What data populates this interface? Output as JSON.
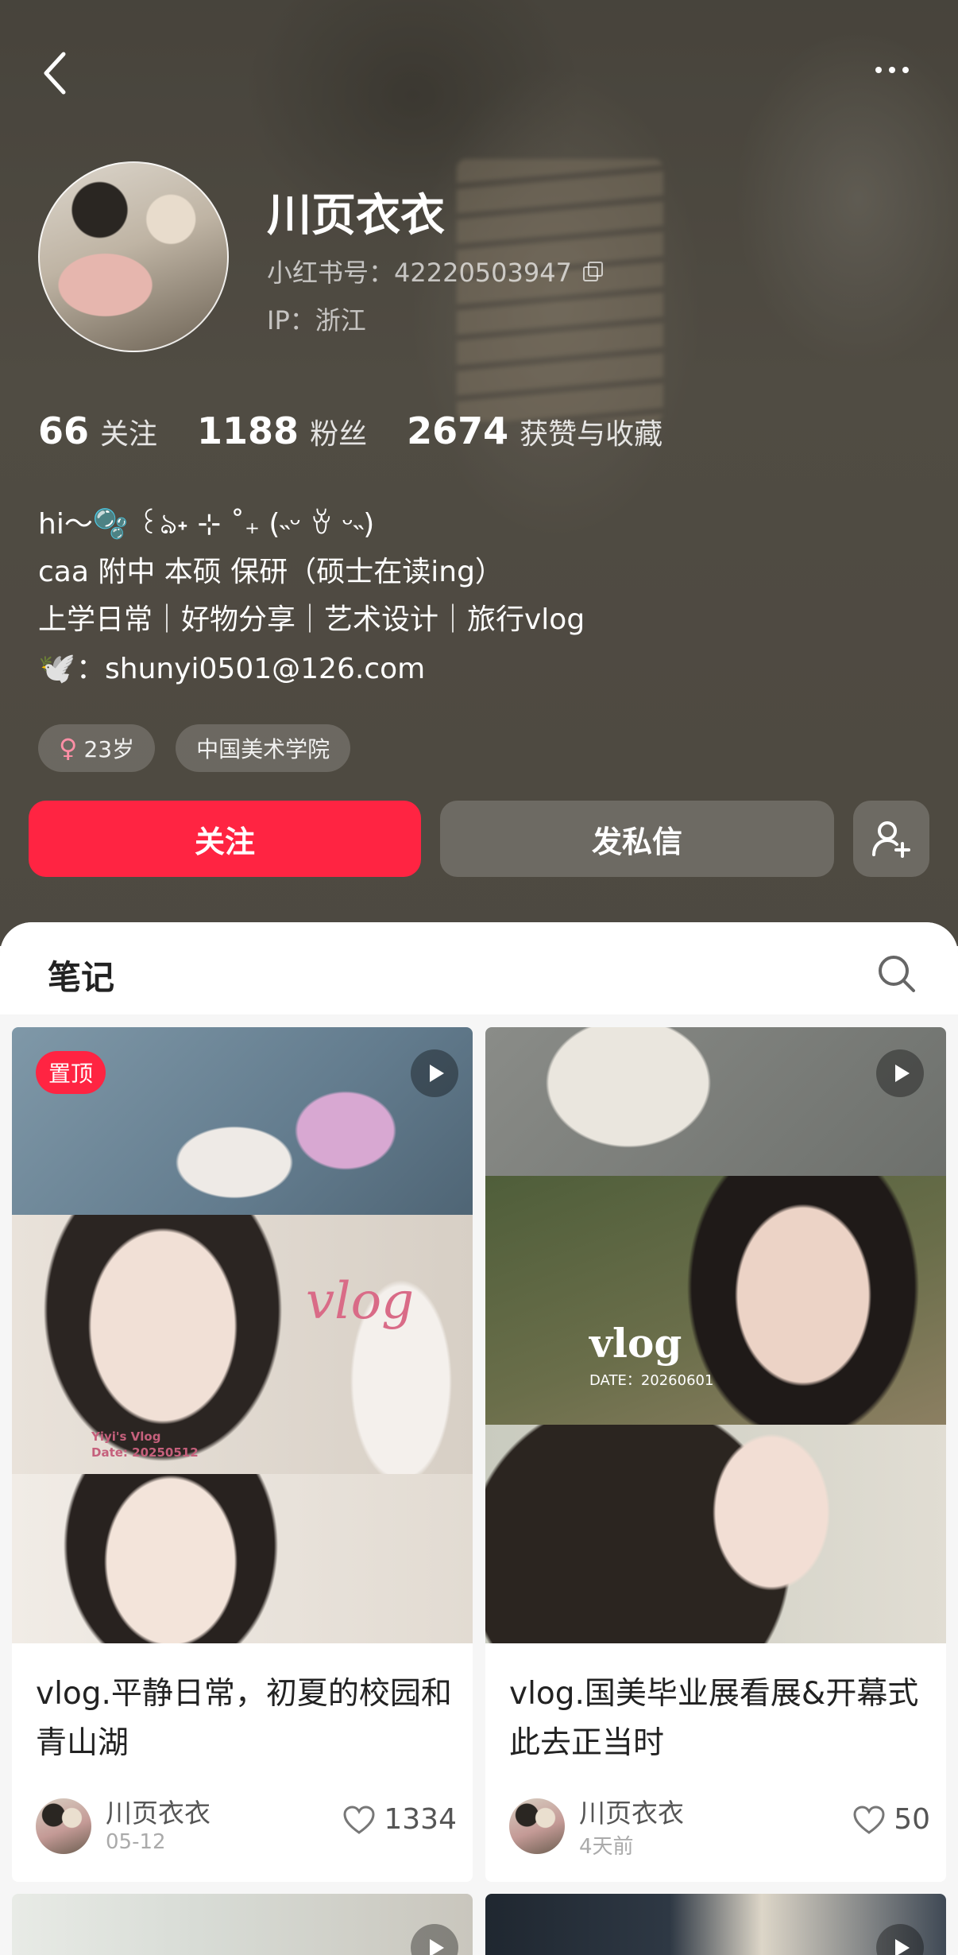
{
  "profile": {
    "username": "川页衣衣",
    "id_label": "小红书号：42220503947",
    "ip_label": "IP：浙江",
    "stats": [
      {
        "num": "66",
        "label": "关注"
      },
      {
        "num": "1188",
        "label": "粉丝"
      },
      {
        "num": "2674",
        "label": "获赞与收藏"
      }
    ],
    "bio": [
      "hi～🫧 ꒰ঌ˖ ⊹ ˚₊ (˵ᵕ ꈊ ᵕ˵)",
      "caa  附中 本硕 保研（硕士在读ing）",
      "上学日常｜好物分享｜艺术设计｜旅行vlog",
      "：shunyi0501@126.com"
    ],
    "dove_icon": "dove-icon",
    "tags": [
      "23岁",
      "中国美术学院"
    ],
    "follow_label": "关注",
    "message_label": "发私信"
  },
  "notes_tab": {
    "label": "笔记"
  },
  "notes": [
    {
      "pinned_label": "置顶",
      "cover_text": "vlog",
      "cover_caption": [
        "Yiyi's Vlog",
        "Date: 20250512"
      ],
      "title": "vlog.平静日常，初夏的校园和青山湖",
      "author": "川页衣衣",
      "date": "05-12",
      "likes": "1334"
    },
    {
      "cover_text": "vlog",
      "cover_caption": "DATE：20260601",
      "title": "vlog.国美毕业展看展&开幕式 此去正当时",
      "author": "川页衣衣",
      "date": "4天前",
      "likes": "50"
    }
  ],
  "colors": {
    "accent": "#ff2442",
    "header_bg": "#57524a"
  }
}
